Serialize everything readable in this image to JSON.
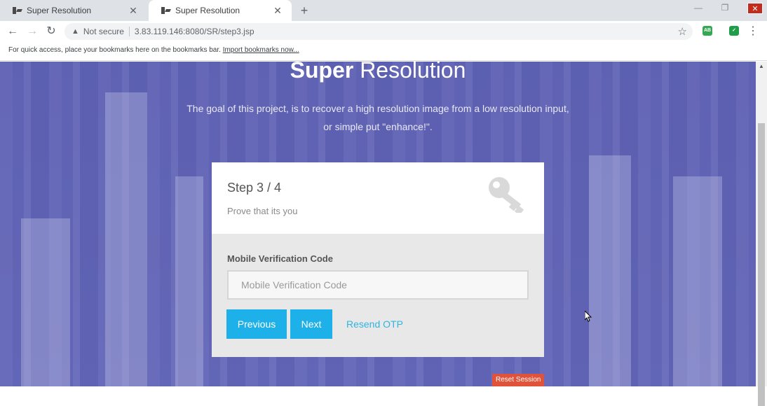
{
  "browser": {
    "tabs": [
      {
        "title": "Super Resolution",
        "active": false
      },
      {
        "title": "Super Resolution",
        "active": true
      }
    ],
    "new_tab": "+",
    "address": {
      "security_label": "Not secure",
      "url": "3.83.119.146:8080/SR/step3.jsp"
    },
    "bookmarks_bar": {
      "prompt": "For quick access, place your bookmarks here on the bookmarks bar.",
      "import_link": "Import bookmarks now..."
    },
    "extensions": [
      {
        "name": "ab-extension-icon",
        "label": "AB",
        "color": "#34a853"
      },
      {
        "name": "shield-extension-icon",
        "label": "✓",
        "color": "#1e9e48"
      }
    ]
  },
  "hero": {
    "title_bold": "Super",
    "title_light": "Resolution",
    "desc_line1": "The goal of this project, is to recover a high resolution image from a low resolution input,",
    "desc_line2": "or simple put \"enhance!\"."
  },
  "card": {
    "step_title": "Step 3 / 4",
    "step_subtitle": "Prove that its you",
    "field_label": "Mobile Verification Code",
    "field_placeholder": "Mobile Verification Code",
    "field_value": "",
    "previous_label": "Previous",
    "next_label": "Next",
    "resend_label": "Resend OTP"
  },
  "reset_session_label": "Reset Session",
  "colors": {
    "accent": "#1eb0e8",
    "link": "#2fb4e0",
    "reset": "#e0533a",
    "overlay": "#5c5fb2"
  }
}
